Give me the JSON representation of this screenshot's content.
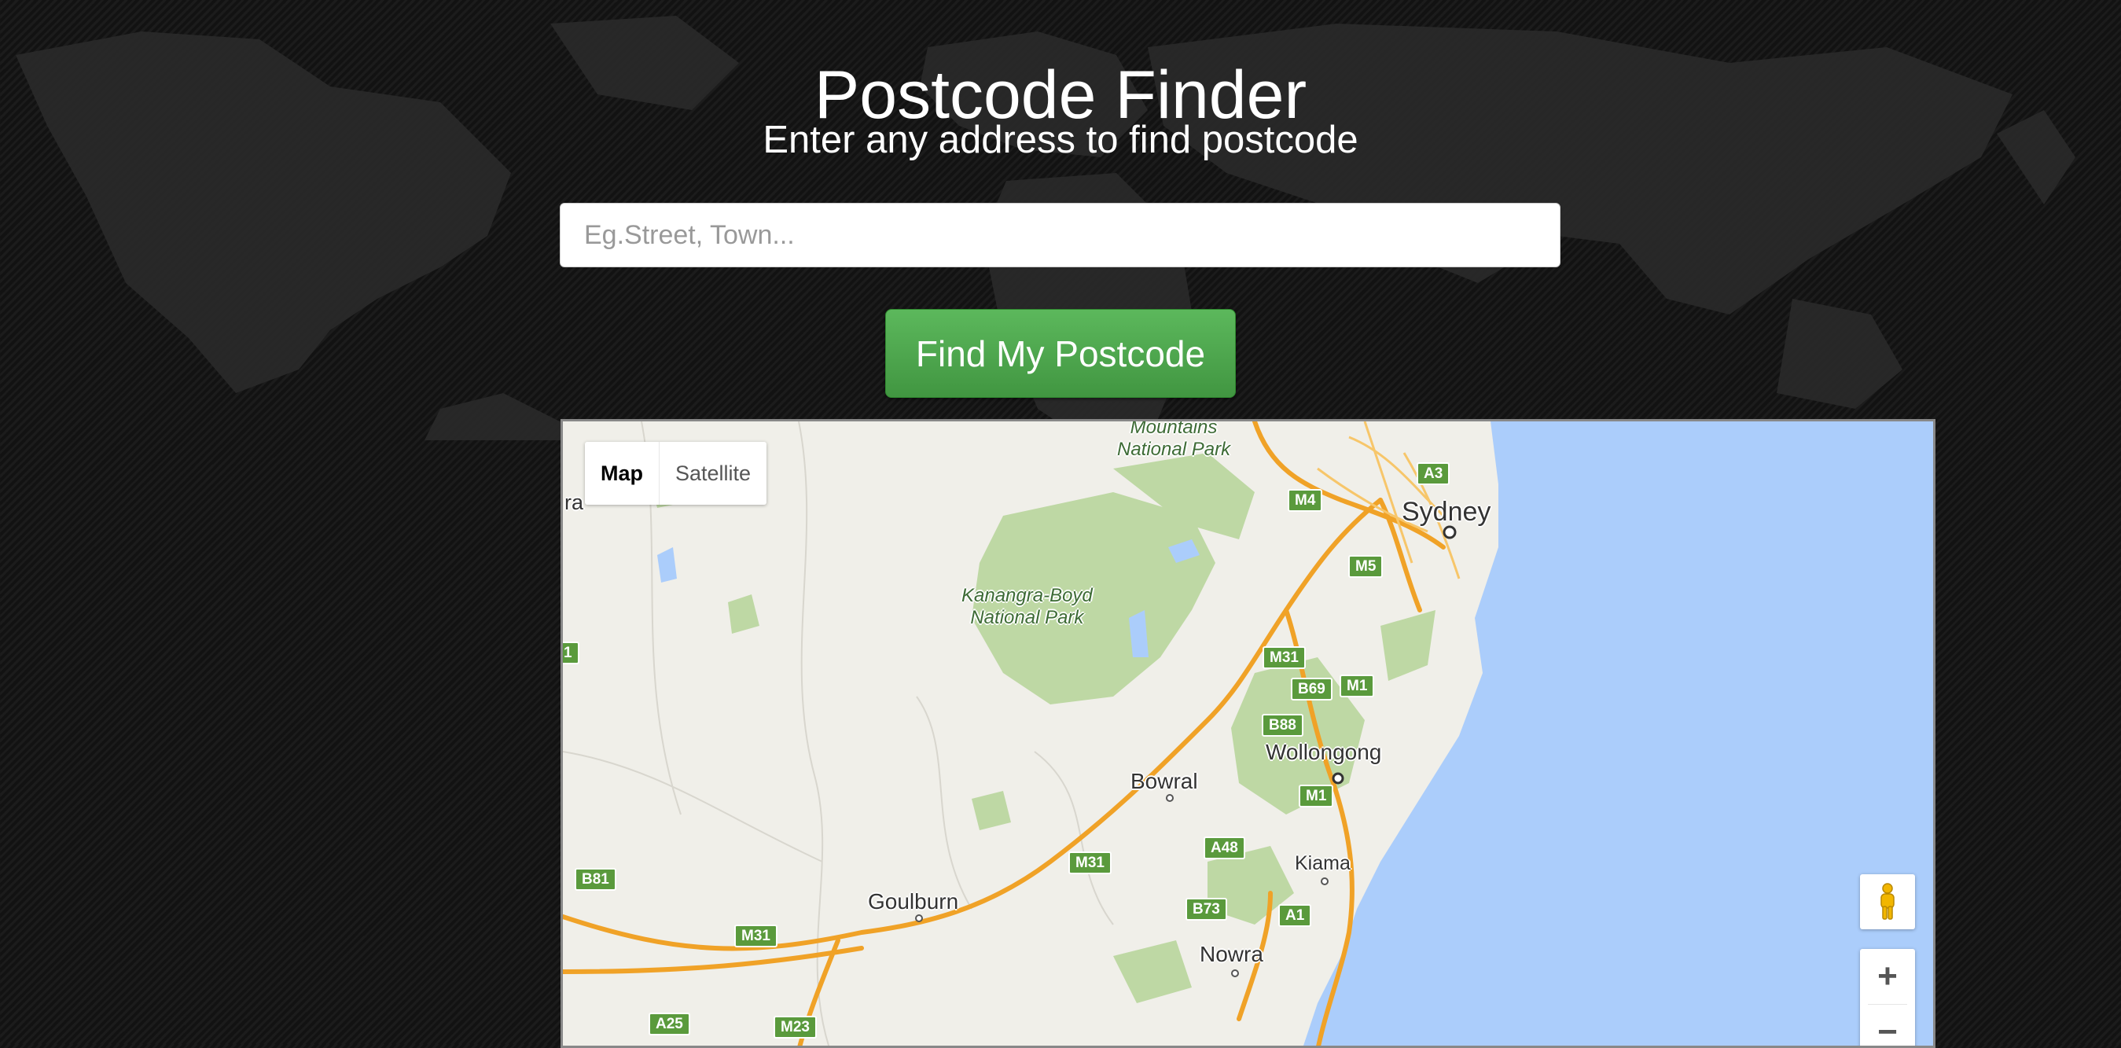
{
  "header": {
    "title": "Postcode Finder",
    "subtitle": "Enter any address to find postcode"
  },
  "search": {
    "placeholder": "Eg.Street, Town...",
    "value": ""
  },
  "actions": {
    "find_label": "Find My Postcode"
  },
  "map": {
    "type_options": [
      {
        "label": "Map",
        "selected": true
      },
      {
        "label": "Satellite",
        "selected": false
      }
    ],
    "cities": [
      "Sydney",
      "Wollongong",
      "Bowral",
      "Kiama",
      "Goulburn",
      "Nowra"
    ],
    "parks": [
      "Mountains\nNational Park",
      "Kanangra-Boyd\nNational Park"
    ],
    "partial_labels": [
      "ra",
      "1"
    ],
    "route_shields": [
      "A3",
      "M4",
      "M5",
      "M31",
      "M31",
      "M31",
      "M1",
      "M1",
      "B69",
      "B88",
      "A48",
      "B73",
      "A1",
      "B81",
      "A25",
      "M23"
    ],
    "zoom_in": "+",
    "zoom_out": "−",
    "icons": [
      "pegman-icon",
      "zoom-in-icon",
      "zoom-out-icon"
    ]
  },
  "colors": {
    "button_green": "#4cae4c",
    "water": "#abcdfb",
    "park": "#bed8a4",
    "highway": "#f0a227",
    "shield_green": "#5a9a3c"
  }
}
